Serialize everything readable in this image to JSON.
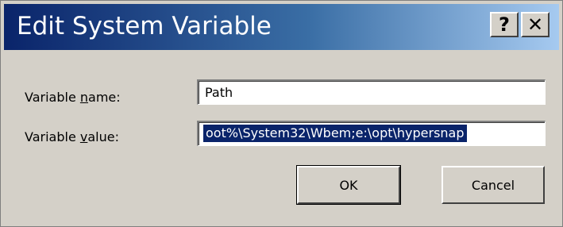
{
  "window": {
    "title": "Edit System Variable",
    "help_glyph": "?",
    "close_glyph": "✕"
  },
  "form": {
    "name_label_pre": "Variable ",
    "name_label_accel": "n",
    "name_label_post": "ame:",
    "value_label_pre": "Variable ",
    "value_label_accel": "v",
    "value_label_post": "alue:",
    "name_value": "Path",
    "value_value": "oot%\\System32\\Wbem;e:\\opt\\hypersnap"
  },
  "buttons": {
    "ok_label": "OK",
    "cancel_label": "Cancel"
  },
  "colors": {
    "titlebar_start": "#0a246a",
    "titlebar_end": "#a6caf0",
    "dialog_bg": "#d4d0c8",
    "selection": "#0a246a"
  },
  "icons": {
    "help": "help-icon",
    "close": "close-icon"
  }
}
